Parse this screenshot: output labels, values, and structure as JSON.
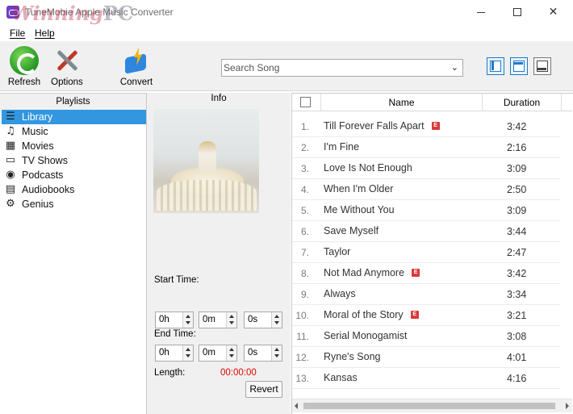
{
  "window": {
    "title": "TuneMobie Apple Music Converter",
    "watermark": "Winning",
    "watermark_suffix": "PC"
  },
  "menu": {
    "file": "File",
    "help": "Help"
  },
  "toolbar": {
    "refresh": "Refresh",
    "options": "Options",
    "convert": "Convert",
    "search_placeholder": "Search Song"
  },
  "playlists": {
    "header": "Playlists",
    "items": [
      {
        "label": "Library",
        "icon": "library-icon",
        "selected": true
      },
      {
        "label": "Music",
        "icon": "music-note-icon"
      },
      {
        "label": "Movies",
        "icon": "film-icon"
      },
      {
        "label": "TV Shows",
        "icon": "tv-icon"
      },
      {
        "label": "Podcasts",
        "icon": "podcast-icon"
      },
      {
        "label": "Audiobooks",
        "icon": "book-icon"
      },
      {
        "label": "Genius",
        "icon": "gear-icon"
      }
    ]
  },
  "info": {
    "header": "Info",
    "start_label": "Start Time:",
    "end_label": "End Time:",
    "length_label": "Length:",
    "length_value": "00:00:00",
    "start": {
      "h": "0h",
      "m": "0m",
      "s": "0s"
    },
    "end": {
      "h": "0h",
      "m": "0m",
      "s": "0s"
    },
    "revert": "Revert"
  },
  "songs": {
    "col_name": "Name",
    "col_duration": "Duration",
    "explicit_badge": "E",
    "rows": [
      {
        "num": "1.",
        "title": "Till Forever Falls Apart",
        "explicit": true,
        "duration": "3:42"
      },
      {
        "num": "2.",
        "title": "I'm Fine",
        "explicit": false,
        "duration": "2:16"
      },
      {
        "num": "3.",
        "title": "Love Is Not Enough",
        "explicit": false,
        "duration": "3:09"
      },
      {
        "num": "4.",
        "title": "When I'm Older",
        "explicit": false,
        "duration": "2:50"
      },
      {
        "num": "5.",
        "title": "Me Without You",
        "explicit": false,
        "duration": "3:09"
      },
      {
        "num": "6.",
        "title": "Save Myself",
        "explicit": false,
        "duration": "3:44"
      },
      {
        "num": "7.",
        "title": "Taylor",
        "explicit": false,
        "duration": "2:47"
      },
      {
        "num": "8.",
        "title": "Not Mad Anymore",
        "explicit": true,
        "duration": "3:42"
      },
      {
        "num": "9.",
        "title": "Always",
        "explicit": false,
        "duration": "3:34"
      },
      {
        "num": "10.",
        "title": "Moral of the Story",
        "explicit": true,
        "duration": "3:21"
      },
      {
        "num": "11.",
        "title": "Serial Monogamist",
        "explicit": false,
        "duration": "3:08"
      },
      {
        "num": "12.",
        "title": "Ryne's Song",
        "explicit": false,
        "duration": "4:01"
      },
      {
        "num": "13.",
        "title": "Kansas",
        "explicit": false,
        "duration": "4:16"
      }
    ]
  },
  "colors": {
    "selection": "#3297e0",
    "length_value": "#e00000",
    "explicit_badge": "#d93a3a",
    "layout_button": "#1e79c8"
  }
}
